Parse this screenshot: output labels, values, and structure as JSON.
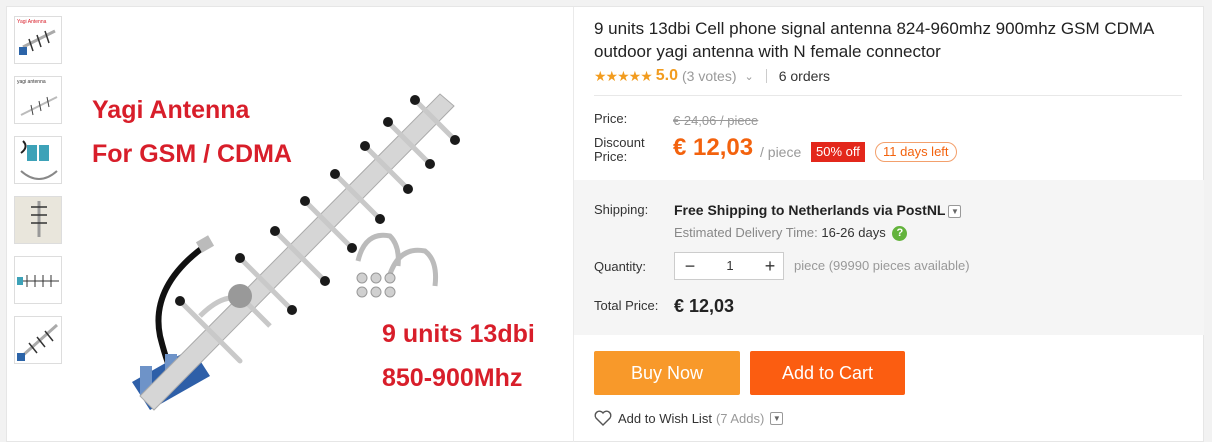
{
  "thumbnails": [
    {
      "name": "thumbnail-1",
      "caption": "Yagi Antenna"
    },
    {
      "name": "thumbnail-2",
      "caption": "yagi antenna"
    },
    {
      "name": "thumbnail-3",
      "caption": ""
    },
    {
      "name": "thumbnail-4",
      "caption": ""
    },
    {
      "name": "thumbnail-5",
      "caption": ""
    },
    {
      "name": "thumbnail-6",
      "caption": ""
    }
  ],
  "image_overlay": {
    "line1": "Yagi Antenna",
    "line2": "For GSM / CDMA",
    "line3": "9 units  13dbi",
    "line4": "850-900Mhz"
  },
  "product": {
    "title": "9 units 13dbi Cell phone signal antenna 824-960mhz 900mhz GSM CDMA outdoor yagi antenna with N female connector",
    "stars": "★★★★★",
    "rating": "5.0",
    "votes": "(3 votes)",
    "orders": "6 orders"
  },
  "price": {
    "price_label": "Price:",
    "original": "€ 24,06 / piece",
    "discount_label_1": "Discount",
    "discount_label_2": "Price:",
    "current": "€ 12,03",
    "unit": "/ piece",
    "discount_badge": "50% off",
    "days_left": "11 days left"
  },
  "shipping": {
    "label": "Shipping:",
    "text": "Free Shipping to Netherlands via PostNL",
    "estimate_label": "Estimated Delivery Time:",
    "estimate_value": "16-26 days"
  },
  "quantity": {
    "label": "Quantity:",
    "minus": "−",
    "value": "1",
    "plus": "+",
    "available": "piece (99990 pieces available)"
  },
  "total": {
    "label": "Total Price:",
    "value": "€ 12,03"
  },
  "actions": {
    "buy_now": "Buy Now",
    "add_to_cart": "Add to Cart",
    "wishlist": "Add to Wish List",
    "wishlist_count": "(7 Adds)"
  },
  "colors": {
    "accent_orange": "#f3620d",
    "buy_button": "#f8992a",
    "cart_button": "#fb5d11",
    "discount_red": "#e3271b",
    "star": "#f29c1f",
    "overlay_text": "#d81e2a"
  }
}
